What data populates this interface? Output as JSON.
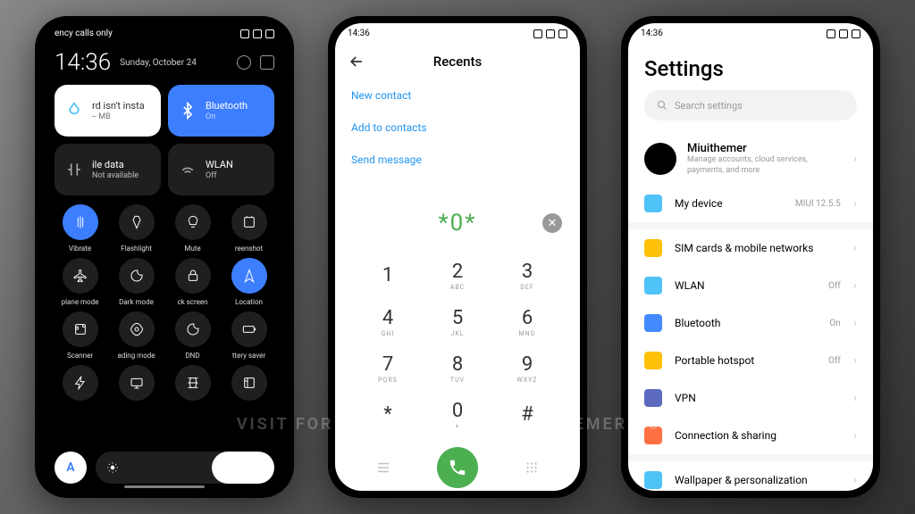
{
  "watermark": "VISIT FOR MORE THEMES - MIUITHEMER.COM",
  "p1": {
    "status": "ency calls only",
    "time": "14:36",
    "date": "Sunday, October 24",
    "tile_card": {
      "label": "rd isn't insta",
      "sub": "-- MB"
    },
    "tile_bt": {
      "label": "Bluetooth",
      "sub": "On"
    },
    "tile_data": {
      "label": "ile data",
      "sub": "Not available"
    },
    "tile_wlan": {
      "label": "WLAN",
      "sub": "Off"
    },
    "toggles": [
      {
        "label": "Vibrate",
        "on": true
      },
      {
        "label": "Flashlight",
        "on": false
      },
      {
        "label": "Mute",
        "on": false
      },
      {
        "label": "reenshot",
        "on": false
      },
      {
        "label": "plane mode",
        "on": false
      },
      {
        "label": "Dark mode",
        "on": false
      },
      {
        "label": "ck screen",
        "on": false
      },
      {
        "label": "Location",
        "on": true
      },
      {
        "label": "Scanner",
        "on": false
      },
      {
        "label": "ading mode",
        "on": false
      },
      {
        "label": "DND",
        "on": false
      },
      {
        "label": "ttery saver",
        "on": false
      },
      {
        "label": "",
        "on": false
      },
      {
        "label": "",
        "on": false
      },
      {
        "label": "",
        "on": false
      },
      {
        "label": "",
        "on": false
      }
    ],
    "auto": "A"
  },
  "p2": {
    "time": "14:36",
    "title": "Recents",
    "actions": [
      "New contact",
      "Add to contacts",
      "Send message"
    ],
    "input": "*0*",
    "keys": [
      {
        "n": "1",
        "l": ""
      },
      {
        "n": "2",
        "l": "ABC"
      },
      {
        "n": "3",
        "l": "DEF"
      },
      {
        "n": "4",
        "l": "GHI"
      },
      {
        "n": "5",
        "l": "JKL"
      },
      {
        "n": "6",
        "l": "MNO"
      },
      {
        "n": "7",
        "l": "PQRS"
      },
      {
        "n": "8",
        "l": "TUV"
      },
      {
        "n": "9",
        "l": "WXYZ"
      },
      {
        "n": "*",
        "l": ""
      },
      {
        "n": "0",
        "l": "+"
      },
      {
        "n": "#",
        "l": ""
      }
    ]
  },
  "p3": {
    "time": "14:36",
    "title": "Settings",
    "search": "Search settings",
    "profile": {
      "name": "Miuithemer",
      "sub": "Manage accounts, cloud services, payments, and more"
    },
    "items": [
      {
        "icon": "#4fc3f7",
        "label": "My device",
        "val": "MIUI 12.5.5"
      },
      {
        "sep": true
      },
      {
        "icon": "#ffc107",
        "label": "SIM cards & mobile networks",
        "val": ""
      },
      {
        "icon": "#4fc3f7",
        "label": "WLAN",
        "val": "Off"
      },
      {
        "icon": "#448aff",
        "label": "Bluetooth",
        "val": "On"
      },
      {
        "icon": "#ffc107",
        "label": "Portable hotspot",
        "val": "Off"
      },
      {
        "icon": "#5c6bc0",
        "label": "VPN",
        "val": ""
      },
      {
        "icon": "#ff7043",
        "label": "Connection & sharing",
        "val": ""
      },
      {
        "sep": true
      },
      {
        "icon": "#4fc3f7",
        "label": "Wallpaper & personalization",
        "val": ""
      }
    ]
  }
}
